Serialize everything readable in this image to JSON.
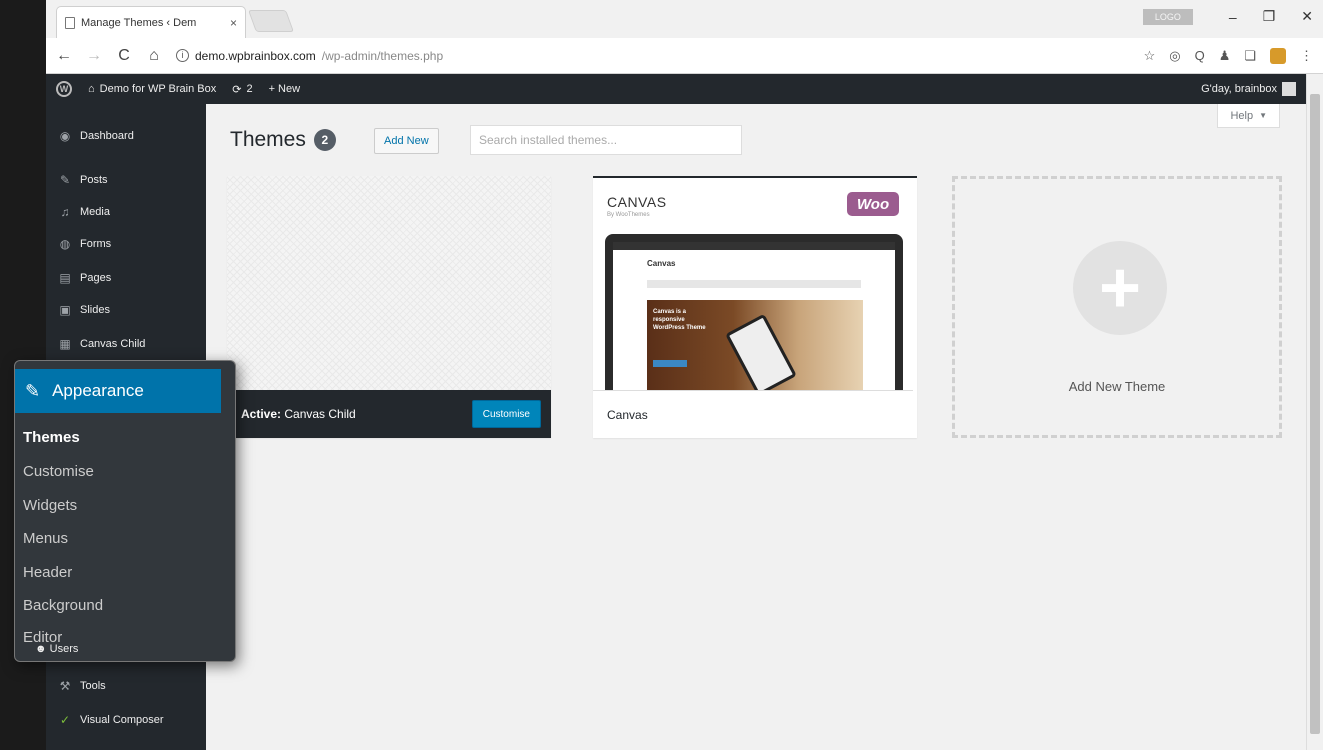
{
  "browser": {
    "tab_title": "Manage Themes ‹ Dem",
    "tab_close": "×",
    "window_user": "LOGO",
    "url_host": "demo.wpbrainbox.com",
    "url_path": "/wp-admin/themes.php",
    "controls": {
      "minimize": "–",
      "maximize": "❐",
      "close": "✕"
    },
    "nav": {
      "back": "←",
      "forward": "→",
      "reload": "C",
      "home": "⌂"
    },
    "info_glyph": "i",
    "extensions": [
      "star-icon",
      "camera-icon",
      "search-icon",
      "ghost-icon",
      "copy-icon",
      "extension-icon",
      "menu-icon"
    ],
    "ext_glyphs": [
      "☆",
      "◎",
      "Q",
      "♟",
      "❏",
      "⋮"
    ]
  },
  "adminbar": {
    "wp_glyph": "W",
    "site_name": "Demo for WP Brain Box",
    "site_icon": "⌂",
    "updates_icon": "⟳",
    "updates_count": "2",
    "new_label": "+ New",
    "greeting": "G'day, brainbox"
  },
  "sidebar": {
    "items": [
      {
        "label": "Dashboard",
        "icon": "dashboard-icon",
        "glyph": "◉"
      },
      {
        "label": "Posts",
        "icon": "pin-icon",
        "glyph": "✎"
      },
      {
        "label": "Media",
        "icon": "media-icon",
        "glyph": "♫"
      },
      {
        "label": "Forms",
        "icon": "forms-icon",
        "glyph": "◍"
      },
      {
        "label": "Pages",
        "icon": "pages-icon",
        "glyph": "▤"
      },
      {
        "label": "Slides",
        "icon": "slides-icon",
        "glyph": "▣"
      },
      {
        "label": "Canvas Child",
        "icon": "canvas-icon",
        "glyph": "▦"
      }
    ],
    "bottom_items": [
      {
        "label": "Users",
        "icon": "users-icon",
        "glyph": "☻"
      },
      {
        "label": "Tools",
        "icon": "wrench-icon",
        "glyph": "⚒"
      },
      {
        "label": "Visual Composer",
        "icon": "vc-icon",
        "glyph": "✓"
      }
    ]
  },
  "appearance_menu": {
    "title": "Appearance",
    "glyph": "✎",
    "items": [
      "Themes",
      "Customise",
      "Widgets",
      "Menus",
      "Header",
      "Background",
      "Editor"
    ],
    "current": "Themes"
  },
  "main": {
    "title": "Themes",
    "count": "2",
    "add_new": "Add New",
    "search_placeholder": "Search installed themes...",
    "help": "Help",
    "help_arrow": "▼"
  },
  "themes": {
    "active": {
      "label_prefix": "Active:",
      "name": "Canvas Child",
      "customise": "Customise"
    },
    "canvas": {
      "name": "Canvas",
      "shot_logo": "CANVAS",
      "shot_by": "By WooThemes",
      "woo": "Woo",
      "shot_title": "Canvas",
      "shot_text": "Canvas is a responsive WordPress Theme"
    },
    "add_new_theme": {
      "label": "Add New Theme",
      "plus": "+"
    }
  }
}
